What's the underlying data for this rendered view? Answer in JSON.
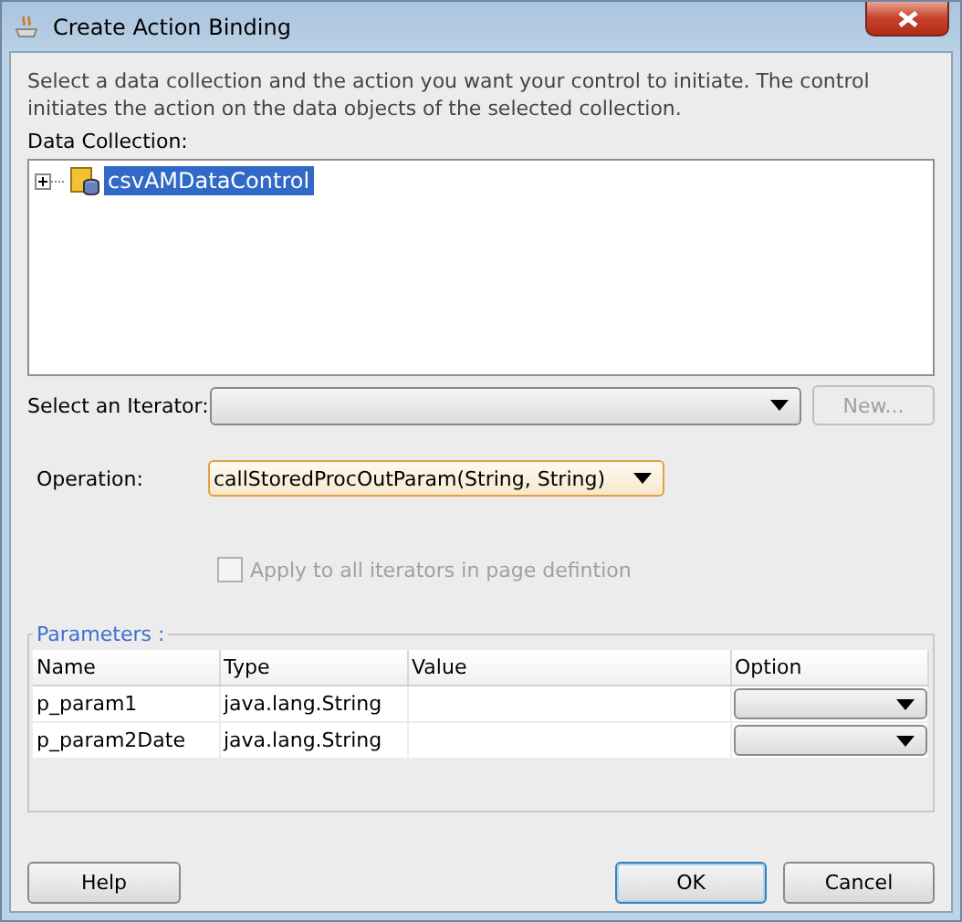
{
  "window": {
    "title": "Create Action Binding"
  },
  "description": "Select a data collection and the action you want your control to initiate. The control initiates the action on the data objects of the selected collection.",
  "data_collection": {
    "label": "Data Collection:",
    "items": [
      {
        "label": "csvAMDataControl",
        "expanded": false,
        "selected": true
      }
    ]
  },
  "iterator": {
    "label": "Select an Iterator:",
    "new_button": {
      "label": "New...",
      "disabled": true
    }
  },
  "operation": {
    "label": "Operation:",
    "value": "callStoredProcOutParam(String, String)"
  },
  "apply_all": {
    "label": "Apply to all iterators in page defintion",
    "checked": false,
    "disabled": true
  },
  "parameters": {
    "title": "Parameters :",
    "columns": [
      "Name",
      "Type",
      "Value",
      "Option"
    ],
    "rows": [
      {
        "name": "p_param1",
        "type": "java.lang.String"
      },
      {
        "name": "p_param2Date",
        "type": "java.lang.String"
      }
    ]
  },
  "buttons": [
    {
      "label": "Help",
      "kind": "help",
      "default": false
    },
    {
      "label": "OK",
      "kind": "ok",
      "default": true
    },
    {
      "label": "Cancel",
      "kind": "cancel",
      "default": false
    }
  ]
}
